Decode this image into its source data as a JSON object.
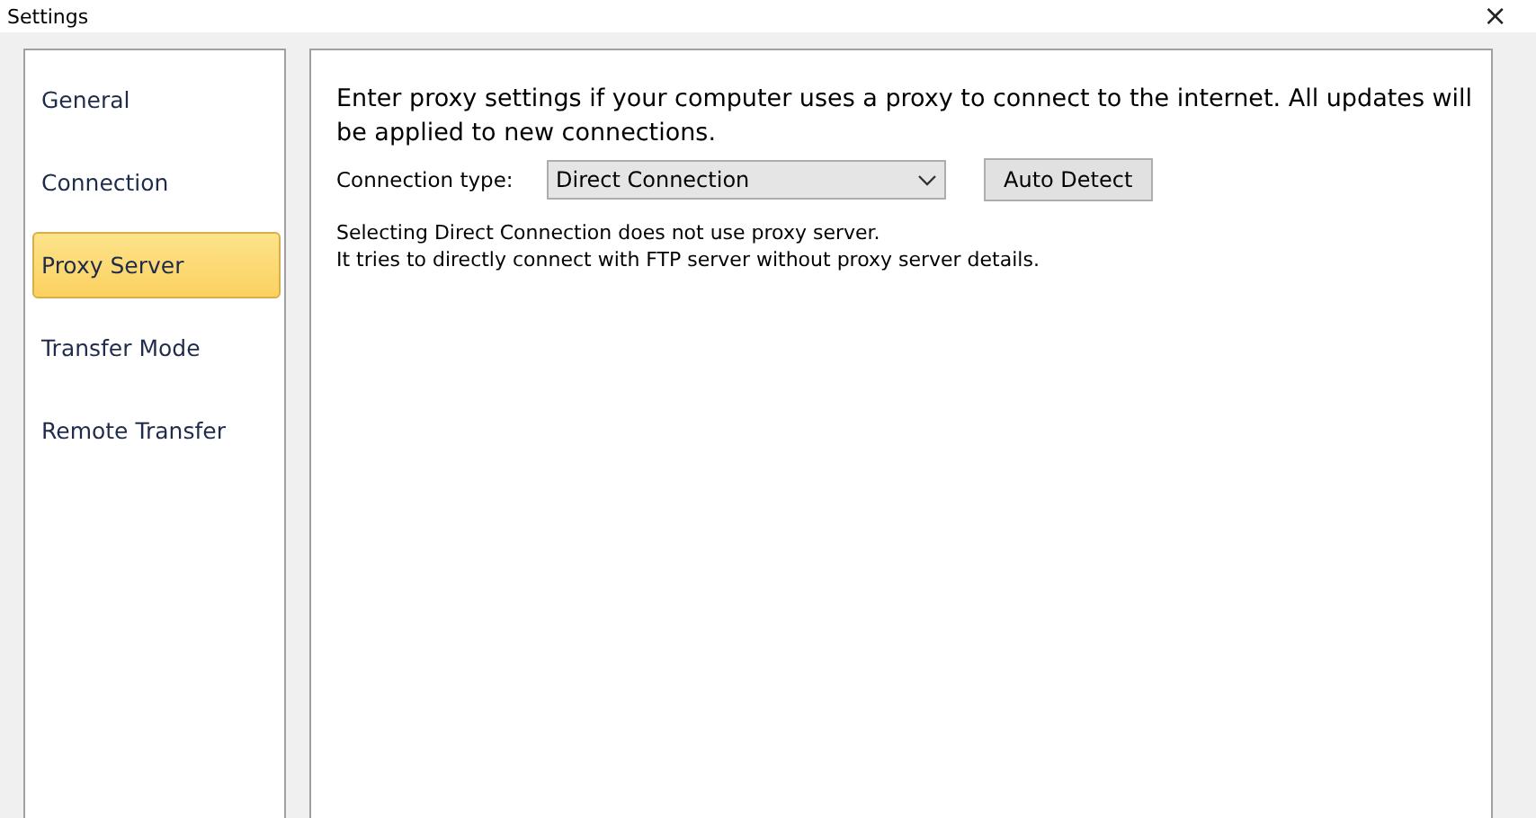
{
  "window": {
    "title": "Settings",
    "close": "×"
  },
  "sidebar": {
    "items": [
      {
        "label": "General",
        "selected": false
      },
      {
        "label": "Connection",
        "selected": false
      },
      {
        "label": "Proxy Server",
        "selected": true
      },
      {
        "label": "Transfer Mode",
        "selected": false
      },
      {
        "label": "Remote Transfer",
        "selected": false
      }
    ]
  },
  "content": {
    "intro": "Enter proxy settings if your computer uses a proxy to connect to the internet. All updates will be applied to new connections.",
    "connection_type": {
      "label": "Connection type:",
      "value": "Direct Connection"
    },
    "auto_detect": "Auto Detect",
    "notes": [
      "Selecting Direct Connection does not use proxy server.",
      "It tries to directly connect with FTP server without proxy server details."
    ]
  }
}
